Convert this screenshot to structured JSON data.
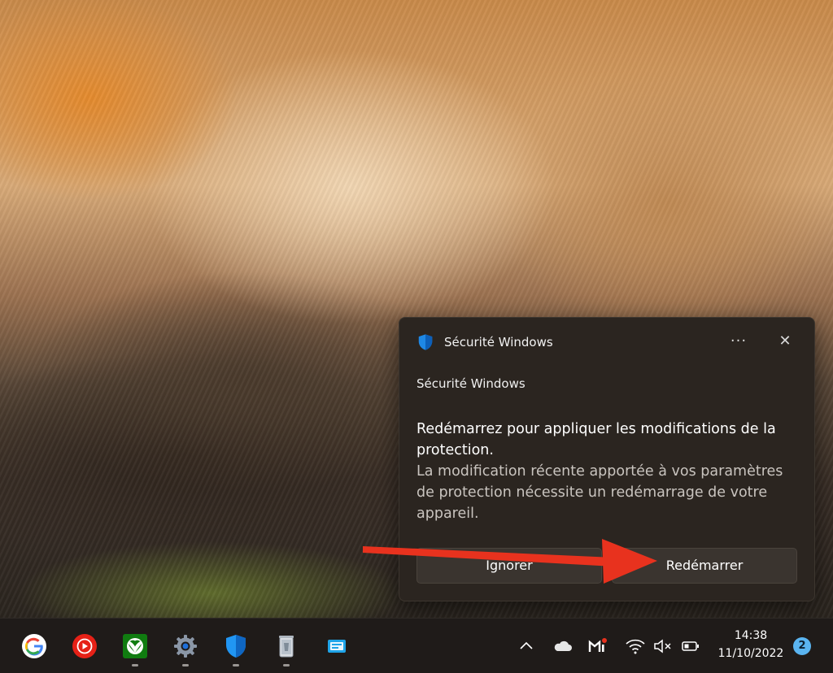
{
  "toast": {
    "app_name": "Sécurité Windows",
    "more_label": "···",
    "close_label": "✕",
    "sender": "Sécurité Windows",
    "title": "Redémarrez pour appliquer les modifications de la protection.",
    "body": "La modification récente apportée à vos paramètres de protection nécessite un redémarrage de votre appareil.",
    "buttons": {
      "ignore": "Ignorer",
      "restart": "Redémarrer"
    },
    "app_icon": "shield-icon"
  },
  "annotation": {
    "arrow_color": "#e8321e"
  },
  "taskbar": {
    "apps": [
      {
        "name": "Google Chrome",
        "icon": "google-icon"
      },
      {
        "name": "YouTube Music",
        "icon": "youtube-music-icon"
      },
      {
        "name": "Xbox",
        "icon": "xbox-icon"
      },
      {
        "name": "Paramètres",
        "icon": "settings-gear-icon"
      },
      {
        "name": "Sécurité Windows",
        "icon": "shield-icon"
      },
      {
        "name": "Corbeille",
        "icon": "recycle-bin-icon"
      },
      {
        "name": "Application",
        "icon": "app-window-icon"
      }
    ],
    "tray_icons": [
      "chevron-up-icon",
      "cloud-icon",
      "gmail-icon",
      "wifi-icon",
      "speaker-muted-icon",
      "battery-icon"
    ],
    "time": "14:38",
    "date": "11/10/2022",
    "notification_count": "2"
  },
  "colors": {
    "accent": "#5ab4f0",
    "toast_bg": "#2b2520",
    "taskbar_bg": "#1f1b19"
  }
}
